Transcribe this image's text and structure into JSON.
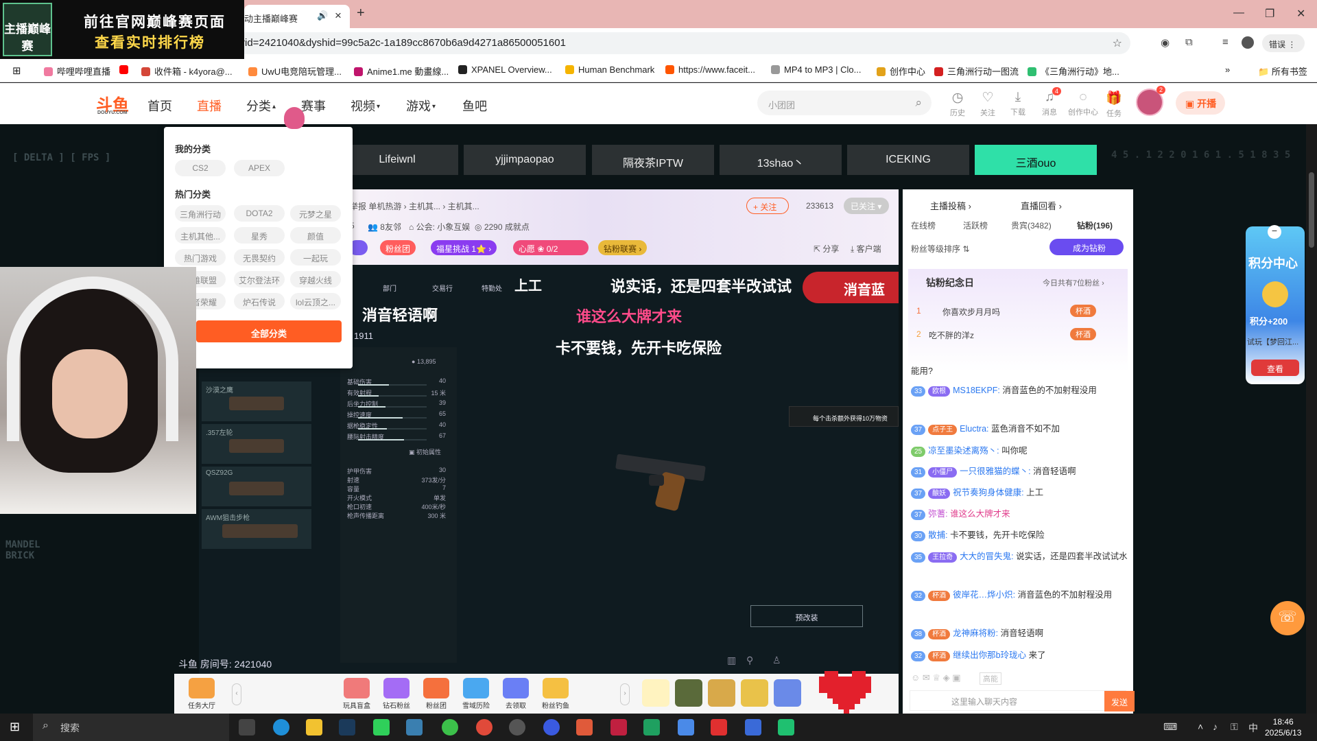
{
  "browser": {
    "active_tab_title": "动主播巅峰赛",
    "new_tab": "+",
    "url": "rid=2421040&dyshid=99c5a2c-1a189cc8670b6a9d4271a86500051601",
    "error_button": "错误",
    "bookmarks": [
      {
        "label": "哔哩哔哩直播",
        "color": "#f07aa0"
      },
      {
        "label": "",
        "color": "#ff0000"
      },
      {
        "label": "收件箱 - k4yora@...",
        "color": "#d44638"
      },
      {
        "label": "UwU电竞陪玩管理...",
        "color": "#ff8a3d"
      },
      {
        "label": "Anime1.me 動畫線...",
        "color": "#c0156c"
      },
      {
        "label": "XPANEL Overview...",
        "color": "#222222"
      },
      {
        "label": "Human Benchmark",
        "color": "#f5b400"
      },
      {
        "label": "https://www.faceit...",
        "color": "#ff5500"
      },
      {
        "label": "MP4 to MP3 | Clo...",
        "color": "#999999"
      },
      {
        "label": "创作中心",
        "color": "#e2a21a"
      },
      {
        "label": "三角洲行动一图流",
        "color": "#d42020"
      },
      {
        "label": "《三角洲行动》地...",
        "color": "#2fbf71"
      }
    ],
    "all_bookmarks": "所有书签"
  },
  "ad": {
    "logo_text": "主播巅峰赛",
    "line1": "前往官网巅峰赛页面",
    "line2": "查看实时排行榜"
  },
  "site": {
    "logo": "斗鱼",
    "logo_sub": "DOUYU.COM",
    "nav": [
      "首页",
      "直播",
      "分类",
      "赛事",
      "视频",
      "游戏",
      "鱼吧"
    ],
    "search_placeholder": "小团团",
    "header_icons": [
      {
        "icon": "history-icon",
        "label": "历史"
      },
      {
        "icon": "heart-icon",
        "label": "关注"
      },
      {
        "icon": "download-icon",
        "label": "下载"
      },
      {
        "icon": "bell-icon",
        "label": "消息",
        "badge": "4"
      },
      {
        "icon": "bulb-icon",
        "label": "创作中心"
      },
      {
        "icon": "gift-icon",
        "label": "任务"
      }
    ],
    "avatar_badge": "2",
    "open_button": "开播"
  },
  "dropdown": {
    "my_heading": "我的分类",
    "my_items": [
      "CS2",
      "APEX"
    ],
    "hot_heading": "热门分类",
    "hot_items": [
      "三角洲行动",
      "DOTA2",
      "元梦之星",
      "主机其他...",
      "星秀",
      "颜值",
      "热门游戏",
      "无畏契约",
      "一起玩",
      "英雄联盟",
      "艾尔登法环",
      "穿越火线",
      "王者荣耀",
      "炉石传说",
      "lol云顶之..."
    ],
    "all_button": "全部分类"
  },
  "streamer_tabs": [
    "Lifeiwnl",
    "yjjimpaopao",
    "隔夜茶IPTW",
    "13shao丶",
    "ICEKING",
    "三酒ouo"
  ],
  "hud": {
    "left_title": "[ DELTA ] [ FPS ]",
    "right_numbers": "4 5 . 1 2 2 0 1   6 1 . 5 1 8 3 5",
    "bottom_left": "MANDEL\nBRICK"
  },
  "room": {
    "breadcrumb": "举报   单机热游 › 主机其... › 主机其...",
    "follow_button": "+ 关注",
    "follower_count": "233613",
    "followed_button": "已关注",
    "fans_count": "5",
    "family": "8友邻",
    "guild": "公会: 小象互娱",
    "achievements": "2290 成就点",
    "pills": [
      {
        "text": "粉丝团",
        "color": "#ff5d5d"
      },
      {
        "text": "福星挑战  1⭐ ›",
        "color": "#8a3cf0"
      },
      {
        "text": "心愿",
        "color": "#f04a7a"
      },
      {
        "text": "0/2",
        "color": "#f04a7a"
      },
      {
        "text": "钻粉联赛 ›",
        "color": "#e9b93a"
      }
    ],
    "share": "分享",
    "client_watch": "客户端"
  },
  "video": {
    "game_tabs": [
      "部门",
      "交易行",
      "特勤处",
      "上工"
    ],
    "title_left": "消音轻语啊",
    "overlay_1": "说实话，还是四套半改试试",
    "overlay_2": "谁这么大牌才来",
    "overlay_3": "卡不要钱，先开卡吃保险",
    "brand_tag": "消音蓝",
    "weapon_name": "1911",
    "price": "13,895",
    "weapons": [
      "沙漠之鹰",
      ".357左轮",
      "QSZ92G",
      "AWM狙击步枪"
    ],
    "stats": [
      {
        "label": "基础伤害",
        "value": "40",
        "pct": 0.45
      },
      {
        "label": "有效射程",
        "value": "15 米",
        "pct": 0.3
      },
      {
        "label": "后坐力控制",
        "value": "39",
        "pct": 0.4
      },
      {
        "label": "操控速度",
        "value": "65",
        "pct": 0.65
      },
      {
        "label": "据枪稳定性",
        "value": "40",
        "pct": 0.42
      },
      {
        "label": "腰际射击精度",
        "value": "67",
        "pct": 0.67
      }
    ],
    "init_attr": "初始属性",
    "details": [
      {
        "label": "护甲伤害",
        "value": "30"
      },
      {
        "label": "射速",
        "value": "373发/分"
      },
      {
        "label": "容量",
        "value": "7"
      },
      {
        "label": "开火模式",
        "value": "单发"
      },
      {
        "label": "枪口初速",
        "value": "400米/秒"
      },
      {
        "label": "枪声传播距离",
        "value": "300 米"
      }
    ],
    "modify_button": "预改装",
    "ad_banner": "每个击杀额外获得10万物资",
    "room_label": "斗鱼 房间号: 2421040"
  },
  "chat": {
    "header_links": [
      "主播投稿 ›",
      "直播回看 ›"
    ],
    "tabs": [
      "在线榜",
      "活跃榜",
      "贵宾(3482)",
      "钻粉(196)"
    ],
    "rank_sort": "粉丝等级排序 ⇅",
    "become_diamond": "成为钻粉",
    "diamond_day": "钻粉纪念日",
    "diamond_today": "今日共有7位粉丝 ›",
    "rank_users": [
      {
        "rank": "1",
        "name": "你喜欢步月月吗",
        "tag": "杯酒"
      },
      {
        "rank": "2",
        "name": "吃不胖的洋z",
        "tag": "杯酒"
      }
    ],
    "partial_line": "能用?",
    "messages": [
      {
        "level": "33",
        "fan": "欧根",
        "user": "MS18EKPF:",
        "text": "消音蓝色的不加射程没用"
      },
      {
        "level": "37",
        "fan": "点子王",
        "user": "Eluctra:",
        "text": "蓝色消音不如不加"
      },
      {
        "level": "25",
        "fan": "",
        "user": "凉至墨染述离殇丶:",
        "text": "叫你呢"
      },
      {
        "level": "31",
        "fan": "小僵尸",
        "user": "一只很雅猫的蝶丶:",
        "text": "消音轻语啊"
      },
      {
        "level": "37",
        "fan": "酿妖",
        "user": "祝节奏狗身体健康:",
        "text": "上工"
      },
      {
        "level": "37",
        "fan": "",
        "user": "弥蓍:",
        "text": "谁这么大牌才来"
      },
      {
        "level": "30",
        "fan": "",
        "user": "散捕:",
        "text": "卡不要钱，先开卡吃保险"
      },
      {
        "level": "35",
        "fan": "王拉奇",
        "user": "大大的冒失鬼:",
        "text": "说实话，还是四套半改试试水"
      },
      {
        "level": "32",
        "fan": "杯酒",
        "user": "彼岸花…烨小炽:",
        "text": "消音蓝色的不加射程没用"
      },
      {
        "level": "38",
        "fan": "杯酒",
        "user": "龙神麻将粉:",
        "text": "消音轻语啊"
      },
      {
        "level": "32",
        "fan": "杯酒",
        "user": "继续出你那b玲珑心",
        "text": "来了"
      }
    ],
    "quality": "高能",
    "input_placeholder": "这里输入聊天内容",
    "send": "发送"
  },
  "promo": {
    "title": "积分中心",
    "points": "积分+200",
    "subtitle": "试玩【梦回江...",
    "view": "查看"
  },
  "gifts": [
    {
      "label": "任务大厅",
      "color": "#f5a142"
    },
    {
      "label": "玩具盲盒",
      "color": "#f07a7a"
    },
    {
      "label": "钻石粉丝",
      "color": "#a46cf5"
    },
    {
      "label": "粉丝团",
      "color": "#f5703d"
    },
    {
      "label": "雪域历险",
      "color": "#4aa8f0"
    },
    {
      "label": "去领取",
      "color": "#6a7ff5"
    },
    {
      "label": "粉丝钓鱼",
      "color": "#f5c042"
    }
  ],
  "taskbar": {
    "search": "搜索",
    "time": "18:46",
    "date": "2025/6/13",
    "ime": "中"
  }
}
